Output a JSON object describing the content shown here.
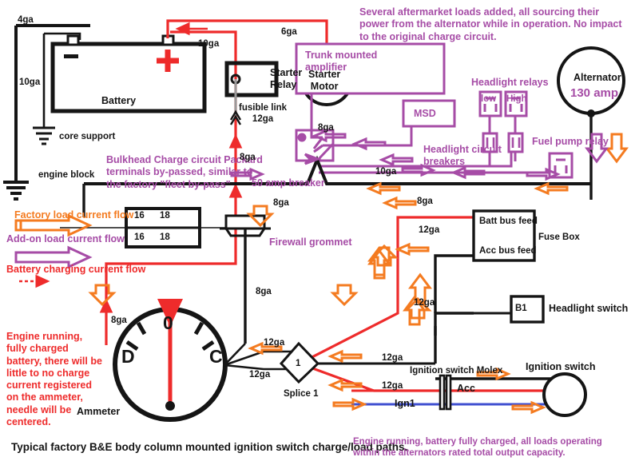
{
  "diagram": {
    "caption_main": "Typical factory B&E body column mounted ignition switch charge/load paths.",
    "caption_right": "Engine running, battery fully charged, all loads operating within the alternators rated total output capacity.",
    "note_top": "Several aftermarket loads added, all sourcing their power from the alternator while in operation. No impact to the original charge circuit.",
    "note_bulkhead": "Bulkhead Charge circuit Packard terminals by-passed, similar to the factory \"fleet by-pass\"",
    "note_ammeter": "Engine running, fully charged battery, there will be little to no charge current registered on the ammeter, needle will be centered."
  },
  "colors": {
    "factory_orange": "#F47B20",
    "addon_purple": "#A64CA6",
    "charge_red": "#EE2B2B",
    "wire_black": "#151515",
    "ign1_blue": "#3F4FD0"
  },
  "legend": {
    "items": [
      {
        "label": "Factory load current flow",
        "color": "#F47B20"
      },
      {
        "label": "Add-on load current flow",
        "color": "#A64CA6"
      },
      {
        "label": "Battery charging current flow",
        "color": "#EE2B2B"
      }
    ]
  },
  "components": {
    "battery": "Battery",
    "battery_positive": "+",
    "battery_negative": "−",
    "core_support": "core support",
    "engine_block": "engine block",
    "starter_relay": "Starter\nRelay",
    "fusible_link": "fusible link\n12ga",
    "starter_motor": "Starter\nMotor",
    "alternator_name": "Alternator",
    "alternator_rating": "130 amp",
    "trunk_amp": "Trunk mounted\namplifier",
    "msd": "MSD",
    "headlight_relays_title": "Headlight relays",
    "relay_low": "low",
    "relay_high": "High",
    "headlight_breakers": "Headlight circuit\nbreakers",
    "fuel_pump_relay": "Fuel pump relay",
    "breaker_50amp": "50 amp breaker",
    "firewall_grommet": "Firewall grommet",
    "bulkhead_terminals": [
      [
        "16",
        "18"
      ],
      [
        "16",
        "18"
      ]
    ],
    "fuse_box": "Fuse Box",
    "batt_bus_feed": "Batt bus feed",
    "acc_bus_feed": "Acc bus feed",
    "headlight_switch": "Headlight switch",
    "headlight_switch_term": "B1",
    "ignition_switch": "Ignition switch",
    "ignition_molex": "Ignition switch Molex",
    "acc_wire": "Acc",
    "ign1_wire": "Ign1",
    "splice_label": "Splice 1",
    "splice_number": "1",
    "ammeter": "Ammeter",
    "ammeter_discharge": "D",
    "ammeter_zero": "0",
    "ammeter_charge": "C"
  },
  "gauges": {
    "bat_ground_4ga": "4ga",
    "bat_ground_10ga": "10ga",
    "bat_pos_10ga": "10ga",
    "starter_6ga": "6ga",
    "amp_feed_8ga": "8ga",
    "bulkhead_8ga": "8ga",
    "breaker_out_8ga": "8ga",
    "grommet_down_8ga": "8ga",
    "ammeter_in_8ga": "8ga",
    "alt_bus_8ga": "8ga",
    "relay_bus_10ga": "10ga",
    "fusebox_12ga": "12ga",
    "acc_feed_12ga": "12ga",
    "hlsw_12ga": "12ga",
    "splice_top_12ga": "12ga",
    "splice_bot_12ga": "12ga",
    "splice_out_12ga": "12ga",
    "splice_red_12ga": "12ga"
  }
}
